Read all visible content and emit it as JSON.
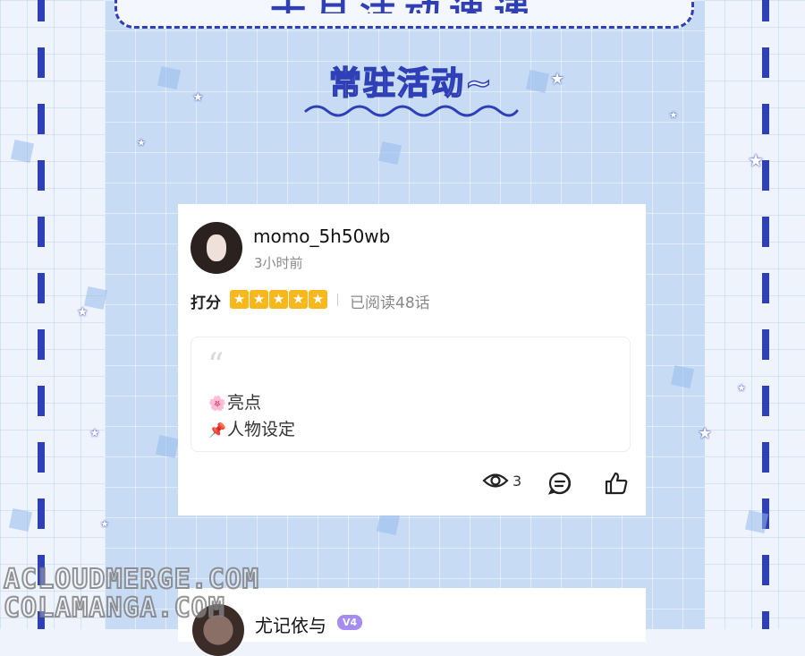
{
  "banner": {
    "title": "十月活动速递"
  },
  "section": {
    "title": "常驻活动~"
  },
  "comment": {
    "username": "momo_5h50wb",
    "time": "3小时前",
    "rating_label": "打分",
    "rating": 5,
    "rating_max": 5,
    "read_status": "已阅读48话",
    "highlight_emoji": "🌸",
    "highlight_text": "亮点",
    "pin_emoji": "📌",
    "pin_text": "人物设定",
    "view_count": "3"
  },
  "next_comment": {
    "username": "尤记依与",
    "vip_badge": "V4"
  },
  "watermark": {
    "line1": "ACLOUDMERGE.COM",
    "line2": "COLAMANGA.COM"
  },
  "colors": {
    "accent": "#2f3fb6",
    "panel": "#c7dcf4",
    "star": "#f6b81c"
  }
}
